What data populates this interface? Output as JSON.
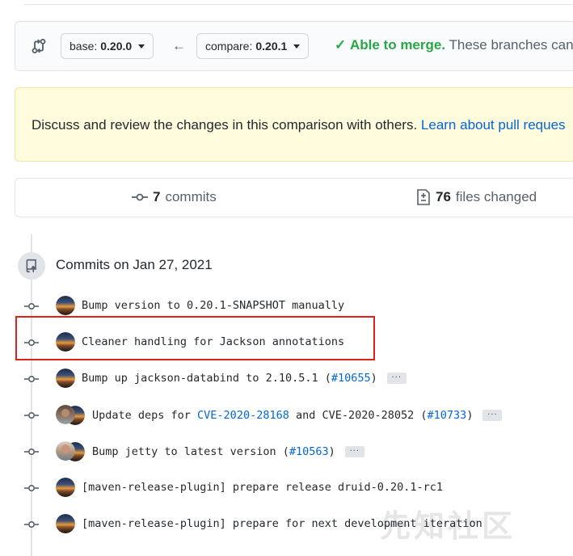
{
  "compare_bar": {
    "base_label": "base:",
    "base_value": "0.20.0",
    "compare_label": "compare:",
    "compare_value": "0.20.1",
    "merge_status": "Able to merge.",
    "merge_message": "These branches can"
  },
  "flash": {
    "text": "Discuss and review the changes in this comparison with others.",
    "link": "Learn about pull reques"
  },
  "summary": {
    "commits_count": "7",
    "commits_label": "commits",
    "files_count": "76",
    "files_label": "files changed"
  },
  "commit_group": {
    "date_label": "Commits on Jan 27, 2021"
  },
  "commits": [
    {
      "message": "Bump version to 0.20.1-SNAPSHOT manually"
    },
    {
      "message": "Cleaner handling for Jackson annotations"
    },
    {
      "message_pre": "Bump up jackson-databind to 2.10.5.1 (",
      "pr": "#10655",
      "message_post": ")",
      "ellipsis": "···"
    },
    {
      "message_pre": "Update deps for ",
      "cve1": "CVE-2020-28168",
      "mid": " and CVE-2020-28052 (",
      "pr": "#10733",
      "message_post": ")",
      "ellipsis": "···"
    },
    {
      "message_pre": "Bump jetty to latest version (",
      "pr": "#10563",
      "message_post": ")",
      "ellipsis": "···"
    },
    {
      "message": "[maven-release-plugin] prepare release druid-0.20.1-rc1"
    },
    {
      "message": "[maven-release-plugin] prepare for next development iteration"
    }
  ],
  "watermark": "先知社区",
  "colors": {
    "success": "#28a745",
    "link": "#0366d6",
    "highlight_box": "#e0201b",
    "flash_bg": "#fffbdd"
  }
}
